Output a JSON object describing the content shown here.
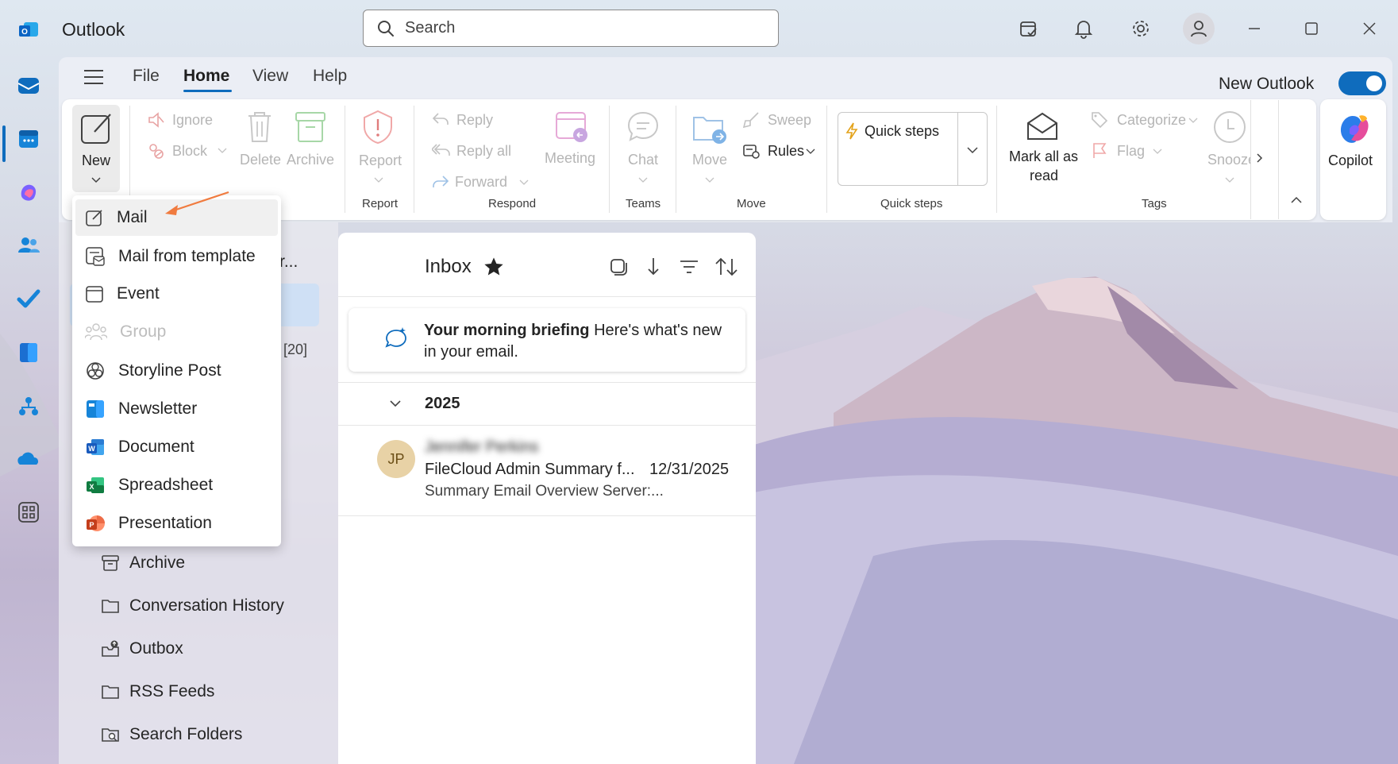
{
  "app": {
    "title": "Outlook"
  },
  "search": {
    "placeholder": "Search"
  },
  "titlebar_icons": [
    "tasks-icon",
    "bell-icon",
    "gear-icon",
    "person-icon",
    "minimize-icon",
    "maximize-icon",
    "close-icon"
  ],
  "rail": [
    "mail-icon",
    "calendar-icon",
    "copilot-icon",
    "people-icon",
    "todo-icon",
    "organizer-icon",
    "org-explorer-icon",
    "onedrive-icon",
    "apps-icon"
  ],
  "tabs": [
    "File",
    "Home",
    "View",
    "Help"
  ],
  "active_tab": "Home",
  "new_outlook": {
    "label": "New Outlook",
    "enabled": true
  },
  "ribbon": {
    "new": "New",
    "ignore": "Ignore",
    "block": "Block",
    "delete": "Delete",
    "archive": "Archive",
    "report": "Report",
    "report_group": "Report",
    "reply": "Reply",
    "reply_all": "Reply all",
    "forward": "Forward",
    "meeting": "Meeting",
    "respond_group": "Respond",
    "chat": "Chat",
    "teams_group": "Teams",
    "move": "Move",
    "sweep": "Sweep",
    "rules": "Rules",
    "move_group": "Move",
    "quick_steps": "Quick steps",
    "quick_steps_group": "Quick steps",
    "mark_all_read_1": "Mark all as",
    "mark_all_read_2": "read",
    "categorize": "Categorize",
    "flag": "Flag",
    "snooze": "Snooze",
    "tags_group": "Tags",
    "copilot": "Copilot"
  },
  "new_menu": {
    "items": [
      {
        "label": "Mail",
        "icon": "compose-icon",
        "disabled": false
      },
      {
        "label": "Mail from template",
        "icon": "template-icon",
        "disabled": false
      },
      {
        "label": "Event",
        "icon": "calendar-icon",
        "disabled": false
      },
      {
        "label": "Group",
        "icon": "group-icon",
        "disabled": true
      },
      {
        "label": "Storyline Post",
        "icon": "storyline-icon",
        "disabled": false
      },
      {
        "label": "Newsletter",
        "icon": "newsletter-icon",
        "disabled": false
      },
      {
        "label": "Document",
        "icon": "word-icon",
        "disabled": false
      },
      {
        "label": "Spreadsheet",
        "icon": "excel-icon",
        "disabled": false
      },
      {
        "label": "Presentation",
        "icon": "powerpoint-icon",
        "disabled": false
      }
    ]
  },
  "folder_pane": {
    "truncated_header": "r...",
    "count": "[20]",
    "folders": [
      {
        "label": "Archive",
        "icon": "archive-icon"
      },
      {
        "label": "Conversation History",
        "icon": "folder-icon"
      },
      {
        "label": "Outbox",
        "icon": "outbox-icon"
      },
      {
        "label": "RSS Feeds",
        "icon": "folder-icon"
      },
      {
        "label": "Search Folders",
        "icon": "search-folder-icon"
      }
    ]
  },
  "message_list": {
    "title": "Inbox",
    "briefing_bold": "Your morning briefing",
    "briefing_rest": " Here's what's new in your email.",
    "year": "2025",
    "messages": [
      {
        "initials": "JP",
        "sender": "Jennifer Perkins",
        "subject": "FileCloud Admin Summary f...",
        "date": "12/31/2025",
        "preview": "Summary Email Overview Server:..."
      }
    ]
  },
  "colors": {
    "accent": "#0f6cbd",
    "avatar_bg": "#e8d2a6"
  }
}
